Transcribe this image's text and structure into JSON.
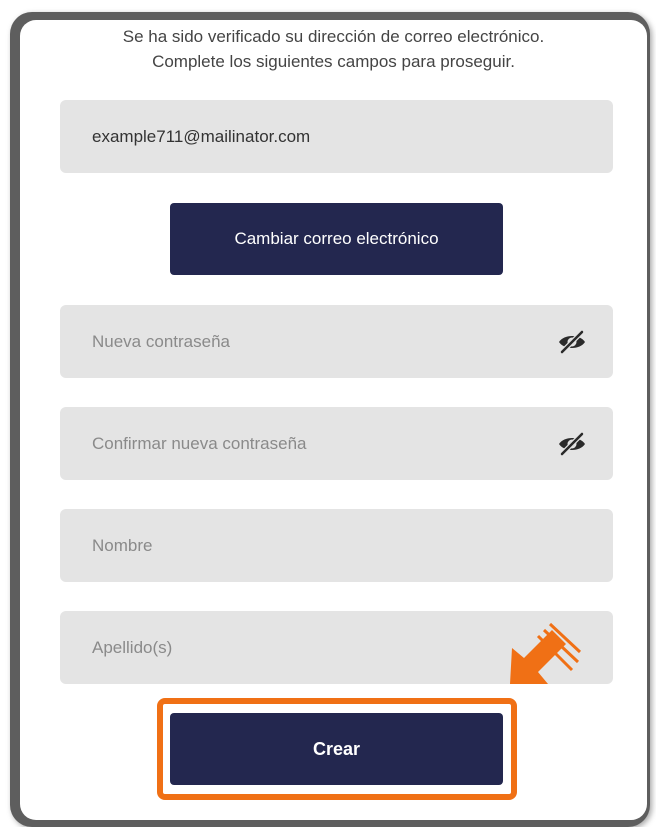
{
  "intro": {
    "line1": "Se ha sido verificado su dirección de correo electrónico.",
    "line2": "Complete los siguientes campos para proseguir."
  },
  "email_field": {
    "value": "example711@mailinator.com"
  },
  "change_email_button": {
    "label": "Cambiar correo electrónico"
  },
  "new_password_field": {
    "placeholder": "Nueva contraseña",
    "icon": "eye-slash-icon"
  },
  "confirm_password_field": {
    "placeholder": "Confirmar nueva contraseña",
    "icon": "eye-slash-icon"
  },
  "first_name_field": {
    "placeholder": "Nombre"
  },
  "last_name_field": {
    "placeholder": "Apellido(s)"
  },
  "create_button": {
    "label": "Crear"
  },
  "annotation": {
    "highlight_color": "#f07015",
    "arrow_icon": "pointer-arrow-icon"
  },
  "colors": {
    "button_bg": "#23274f",
    "field_bg": "#e4e4e4",
    "frame": "#5e5e5e"
  }
}
